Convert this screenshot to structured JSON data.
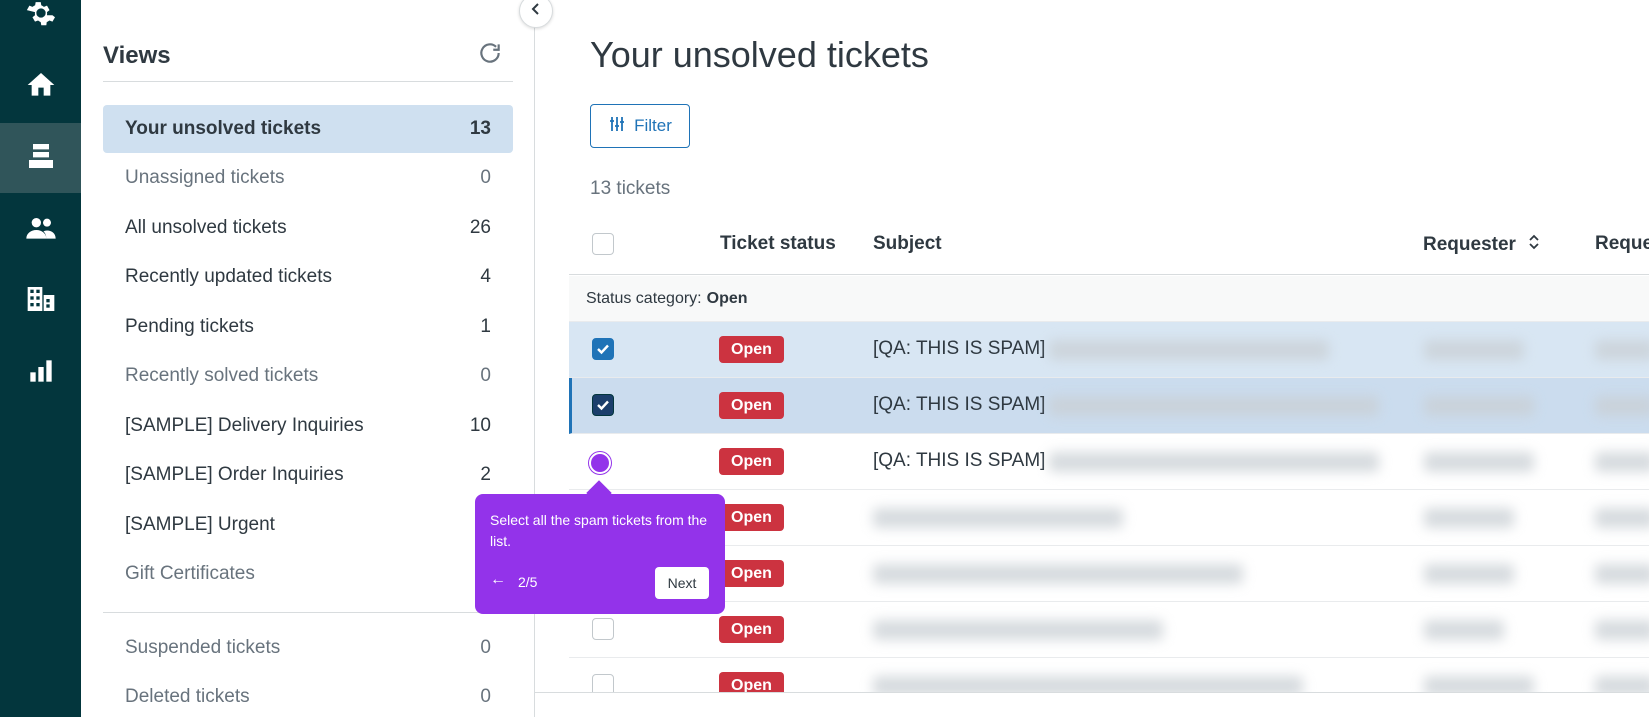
{
  "nav_rail": {
    "items": [
      {
        "icon": "gear-icon"
      },
      {
        "icon": "home-icon"
      },
      {
        "icon": "tickets-icon",
        "active": true
      },
      {
        "icon": "users-icon"
      },
      {
        "icon": "organizations-icon"
      },
      {
        "icon": "reports-icon"
      }
    ]
  },
  "views": {
    "title": "Views",
    "items": [
      {
        "label": "Your unsolved tickets",
        "count": "13"
      },
      {
        "label": "Unassigned tickets",
        "count": "0"
      },
      {
        "label": "All unsolved tickets",
        "count": "26"
      },
      {
        "label": "Recently updated tickets",
        "count": "4"
      },
      {
        "label": "Pending tickets",
        "count": "1"
      },
      {
        "label": "Recently solved tickets",
        "count": "0"
      },
      {
        "label": "[SAMPLE] Delivery Inquiries",
        "count": "10"
      },
      {
        "label": "[SAMPLE] Order Inquiries",
        "count": "2"
      },
      {
        "label": "[SAMPLE] Urgent",
        "count": ""
      },
      {
        "label": "Gift Certificates",
        "count": ""
      }
    ],
    "secondary": [
      {
        "label": "Suspended tickets",
        "count": "0"
      },
      {
        "label": "Deleted tickets",
        "count": "0"
      }
    ]
  },
  "main": {
    "title": "Your unsolved tickets",
    "filter_label": "Filter",
    "ticket_count": "13 tickets",
    "columns": {
      "status": "Ticket status",
      "subject": "Subject",
      "requester": "Requester",
      "requester_updated": "Reque"
    },
    "group_label": "Status category:",
    "group_value": "Open",
    "rows": [
      {
        "status": "Open",
        "subject": "[QA: THIS IS SPAM]",
        "checked": true
      },
      {
        "status": "Open",
        "subject": "[QA: THIS IS SPAM]",
        "checked": true
      },
      {
        "status": "Open",
        "subject": "[QA: THIS IS SPAM]",
        "checked": false
      },
      {
        "status": "Open",
        "subject": "",
        "checked": false
      },
      {
        "status": "Open",
        "subject": "",
        "checked": false
      },
      {
        "status": "Open",
        "subject": "",
        "checked": false
      },
      {
        "status": "Open",
        "subject": "",
        "checked": false
      }
    ]
  },
  "tooltip": {
    "text": "Select all the spam tickets from the list.",
    "back_icon": "arrow-left-icon",
    "step": "2/5",
    "next_label": "Next"
  },
  "colors": {
    "rail": "#03363d",
    "accent": "#1f73b7",
    "status_open": "#cc3340",
    "tooltip": "#9333ea"
  }
}
